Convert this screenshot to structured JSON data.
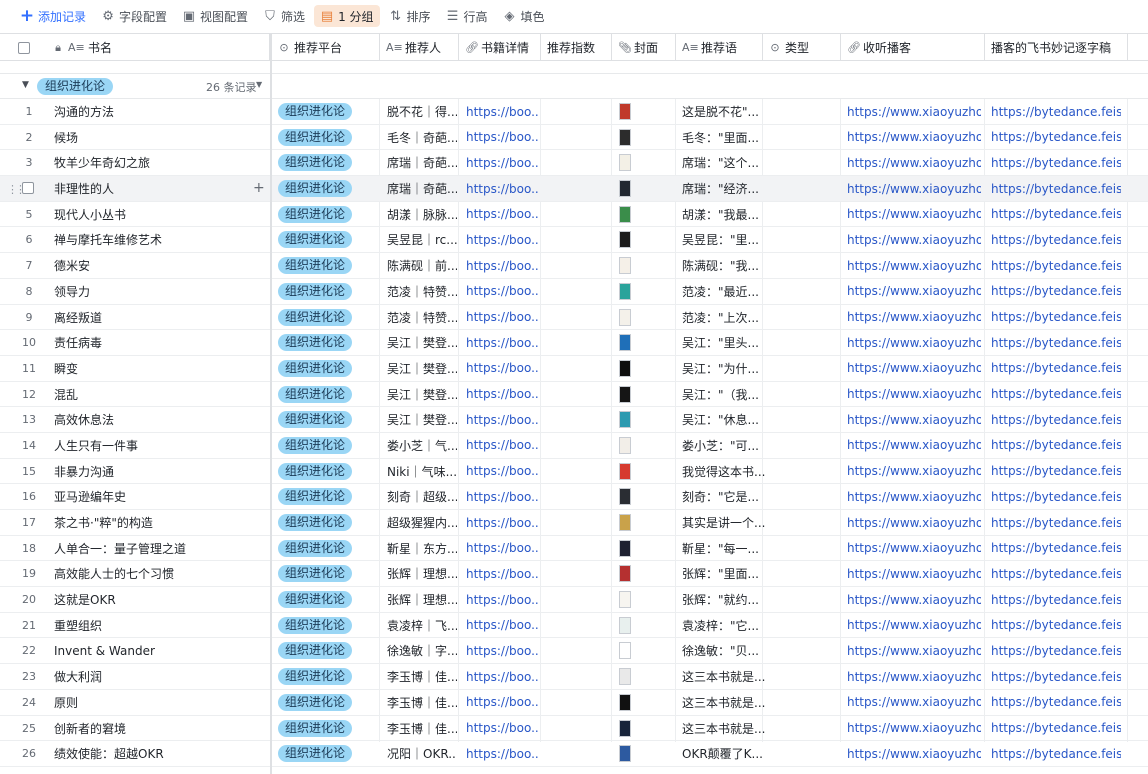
{
  "toolbar": {
    "add": "添加记录",
    "fields": "字段配置",
    "view": "视图配置",
    "filter": "筛选",
    "group": "1 分组",
    "sort": "排序",
    "row_height": "行高",
    "fill": "填色"
  },
  "columns": {
    "name": "书名",
    "platform": "推荐平台",
    "recommender": "推荐人",
    "detail": "书籍详情",
    "index": "推荐指数",
    "cover": "封面",
    "quote": "推荐语",
    "type": "类型",
    "podcast": "收听播客",
    "transcript": "播客的飞书妙记逐字稿"
  },
  "group": {
    "label": "组织进化论",
    "count": "26 条记录"
  },
  "colors": {
    "accent": "#3370ff",
    "tag_bg": "#9ad6f5",
    "link": "#2856c7"
  },
  "rows": [
    {
      "idx": "1",
      "name": "沟通的方法",
      "platform": "组织进化论",
      "recommender": "脱不花｜得...",
      "detail": "https://boo...",
      "quote": "这是脱不花\"...",
      "podcast": "https://www.xiaoyuzhou...",
      "transcript": "https://bytedance.feishu..."
    },
    {
      "idx": "2",
      "name": "候场",
      "platform": "组织进化论",
      "recommender": "毛冬｜奇葩...",
      "detail": "https://boo...",
      "quote": "毛冬：\"里面...",
      "podcast": "https://www.xiaoyuzhou...",
      "transcript": "https://bytedance.feishu..."
    },
    {
      "idx": "3",
      "name": "牧羊少年奇幻之旅",
      "platform": "组织进化论",
      "recommender": "席瑞｜奇葩...",
      "detail": "https://boo...",
      "quote": "席瑞：\"这个...",
      "podcast": "https://www.xiaoyuzhou...",
      "transcript": "https://bytedance.feishu..."
    },
    {
      "idx": "",
      "name": "非理性的人",
      "platform": "组织进化论",
      "recommender": "席瑞｜奇葩...",
      "detail": "https://boo...",
      "quote": "席瑞：\"经济...",
      "podcast": "https://www.xiaoyuzhou...",
      "transcript": "https://bytedance.feishu..."
    },
    {
      "idx": "5",
      "name": "现代人小丛书",
      "platform": "组织进化论",
      "recommender": "胡漾｜脉脉...",
      "detail": "https://boo...",
      "quote": "胡漾：\"我最...",
      "podcast": "https://www.xiaoyuzhou...",
      "transcript": "https://bytedance.feishu..."
    },
    {
      "idx": "6",
      "name": "禅与摩托车维修艺术",
      "platform": "组织进化论",
      "recommender": "吴昱昆｜rc...",
      "detail": "https://boo...",
      "quote": "吴昱昆：\"里...",
      "podcast": "https://www.xiaoyuzhou...",
      "transcript": "https://bytedance.feishu..."
    },
    {
      "idx": "7",
      "name": "德米安",
      "platform": "组织进化论",
      "recommender": "陈满砚｜前...",
      "detail": "https://boo...",
      "quote": "陈满砚：\"我...",
      "podcast": "https://www.xiaoyuzhou...",
      "transcript": "https://bytedance.feishu..."
    },
    {
      "idx": "8",
      "name": "领导力",
      "platform": "组织进化论",
      "recommender": "范凌｜特赞...",
      "detail": "https://boo...",
      "quote": "范凌：\"最近...",
      "podcast": "https://www.xiaoyuzhou...",
      "transcript": "https://bytedance.feishu..."
    },
    {
      "idx": "9",
      "name": "离经叛道",
      "platform": "组织进化论",
      "recommender": "范凌｜特赞...",
      "detail": "https://boo...",
      "quote": "范凌：\"上次...",
      "podcast": "https://www.xiaoyuzhou...",
      "transcript": "https://bytedance.feishu..."
    },
    {
      "idx": "10",
      "name": "责任病毒",
      "platform": "组织进化论",
      "recommender": "吴江｜樊登...",
      "detail": "https://boo...",
      "quote": "吴江：\"里头...",
      "podcast": "https://www.xiaoyuzhou...",
      "transcript": "https://bytedance.feishu..."
    },
    {
      "idx": "11",
      "name": "瞬变",
      "platform": "组织进化论",
      "recommender": "吴江｜樊登...",
      "detail": "https://boo...",
      "quote": "吴江：\"为什...",
      "podcast": "https://www.xiaoyuzhou...",
      "transcript": "https://bytedance.feishu..."
    },
    {
      "idx": "12",
      "name": "混乱",
      "platform": "组织进化论",
      "recommender": "吴江｜樊登...",
      "detail": "https://boo...",
      "quote": "吴江：\"（我...",
      "podcast": "https://www.xiaoyuzhou...",
      "transcript": "https://bytedance.feishu..."
    },
    {
      "idx": "13",
      "name": "高效休息法",
      "platform": "组织进化论",
      "recommender": "吴江｜樊登...",
      "detail": "https://boo...",
      "quote": "吴江：\"休息...",
      "podcast": "https://www.xiaoyuzhou...",
      "transcript": "https://bytedance.feishu..."
    },
    {
      "idx": "14",
      "name": "人生只有一件事",
      "platform": "组织进化论",
      "recommender": "娄小芝｜气...",
      "detail": "https://boo...",
      "quote": "娄小芝：\"可...",
      "podcast": "https://www.xiaoyuzhou...",
      "transcript": "https://bytedance.feishu..."
    },
    {
      "idx": "15",
      "name": "非暴力沟通",
      "platform": "组织进化论",
      "recommender": "Niki｜气味...",
      "detail": "https://boo...",
      "quote": "我觉得这本书...",
      "podcast": "https://www.xiaoyuzhou...",
      "transcript": "https://bytedance.feishu..."
    },
    {
      "idx": "16",
      "name": "亚马逊编年史",
      "platform": "组织进化论",
      "recommender": "刻奇｜超级...",
      "detail": "https://boo...",
      "quote": "刻奇：\"它是...",
      "podcast": "https://www.xiaoyuzhou...",
      "transcript": "https://bytedance.feishu..."
    },
    {
      "idx": "17",
      "name": "茶之书·\"粹\"的构造",
      "platform": "组织进化论",
      "recommender": "超级猩猩内...",
      "detail": "https://boo...",
      "quote": "其实是讲一个...",
      "podcast": "https://www.xiaoyuzhou...",
      "transcript": "https://bytedance.feishu..."
    },
    {
      "idx": "18",
      "name": "人单合一：量子管理之道",
      "platform": "组织进化论",
      "recommender": "靳星｜东方...",
      "detail": "https://boo...",
      "quote": "靳星：\"每一...",
      "podcast": "https://www.xiaoyuzhou...",
      "transcript": "https://bytedance.feishu..."
    },
    {
      "idx": "19",
      "name": "高效能人士的七个习惯",
      "platform": "组织进化论",
      "recommender": "张辉｜理想...",
      "detail": "https://boo...",
      "quote": "张辉：\"里面...",
      "podcast": "https://www.xiaoyuzhou...",
      "transcript": "https://bytedance.feishu..."
    },
    {
      "idx": "20",
      "name": "这就是OKR",
      "platform": "组织进化论",
      "recommender": "张辉｜理想...",
      "detail": "https://boo...",
      "quote": "张辉：\"就约...",
      "podcast": "https://www.xiaoyuzhou...",
      "transcript": "https://bytedance.feishu..."
    },
    {
      "idx": "21",
      "name": "重塑组织",
      "platform": "组织进化论",
      "recommender": "袁凌梓｜飞...",
      "detail": "https://boo...",
      "quote": "袁凌梓：\"它...",
      "podcast": "https://www.xiaoyuzhou...",
      "transcript": "https://bytedance.feishu..."
    },
    {
      "idx": "22",
      "name": "Invent & Wander",
      "platform": "组织进化论",
      "recommender": "徐逸敏｜字...",
      "detail": "https://boo...",
      "quote": "徐逸敏：\"贝...",
      "podcast": "https://www.xiaoyuzhou...",
      "transcript": "https://bytedance.feishu..."
    },
    {
      "idx": "23",
      "name": "做大利润",
      "platform": "组织进化论",
      "recommender": "李玉博｜佳...",
      "detail": "https://boo...",
      "quote": "这三本书就是...",
      "podcast": "https://www.xiaoyuzhou...",
      "transcript": "https://bytedance.feishu..."
    },
    {
      "idx": "24",
      "name": "原则",
      "platform": "组织进化论",
      "recommender": "李玉博｜佳...",
      "detail": "https://boo...",
      "quote": "这三本书就是...",
      "podcast": "https://www.xiaoyuzhou...",
      "transcript": "https://bytedance.feishu..."
    },
    {
      "idx": "25",
      "name": "创新者的窘境",
      "platform": "组织进化论",
      "recommender": "李玉博｜佳...",
      "detail": "https://boo...",
      "quote": "这三本书就是...",
      "podcast": "https://www.xiaoyuzhou...",
      "transcript": "https://bytedance.feishu..."
    },
    {
      "idx": "26",
      "name": "绩效使能：超越OKR",
      "platform": "组织进化论",
      "recommender": "况阳｜OKR...",
      "detail": "https://boo...",
      "quote": "OKR颠覆了K...",
      "podcast": "https://www.xiaoyuzhou...",
      "transcript": "https://bytedance.feishu..."
    }
  ]
}
